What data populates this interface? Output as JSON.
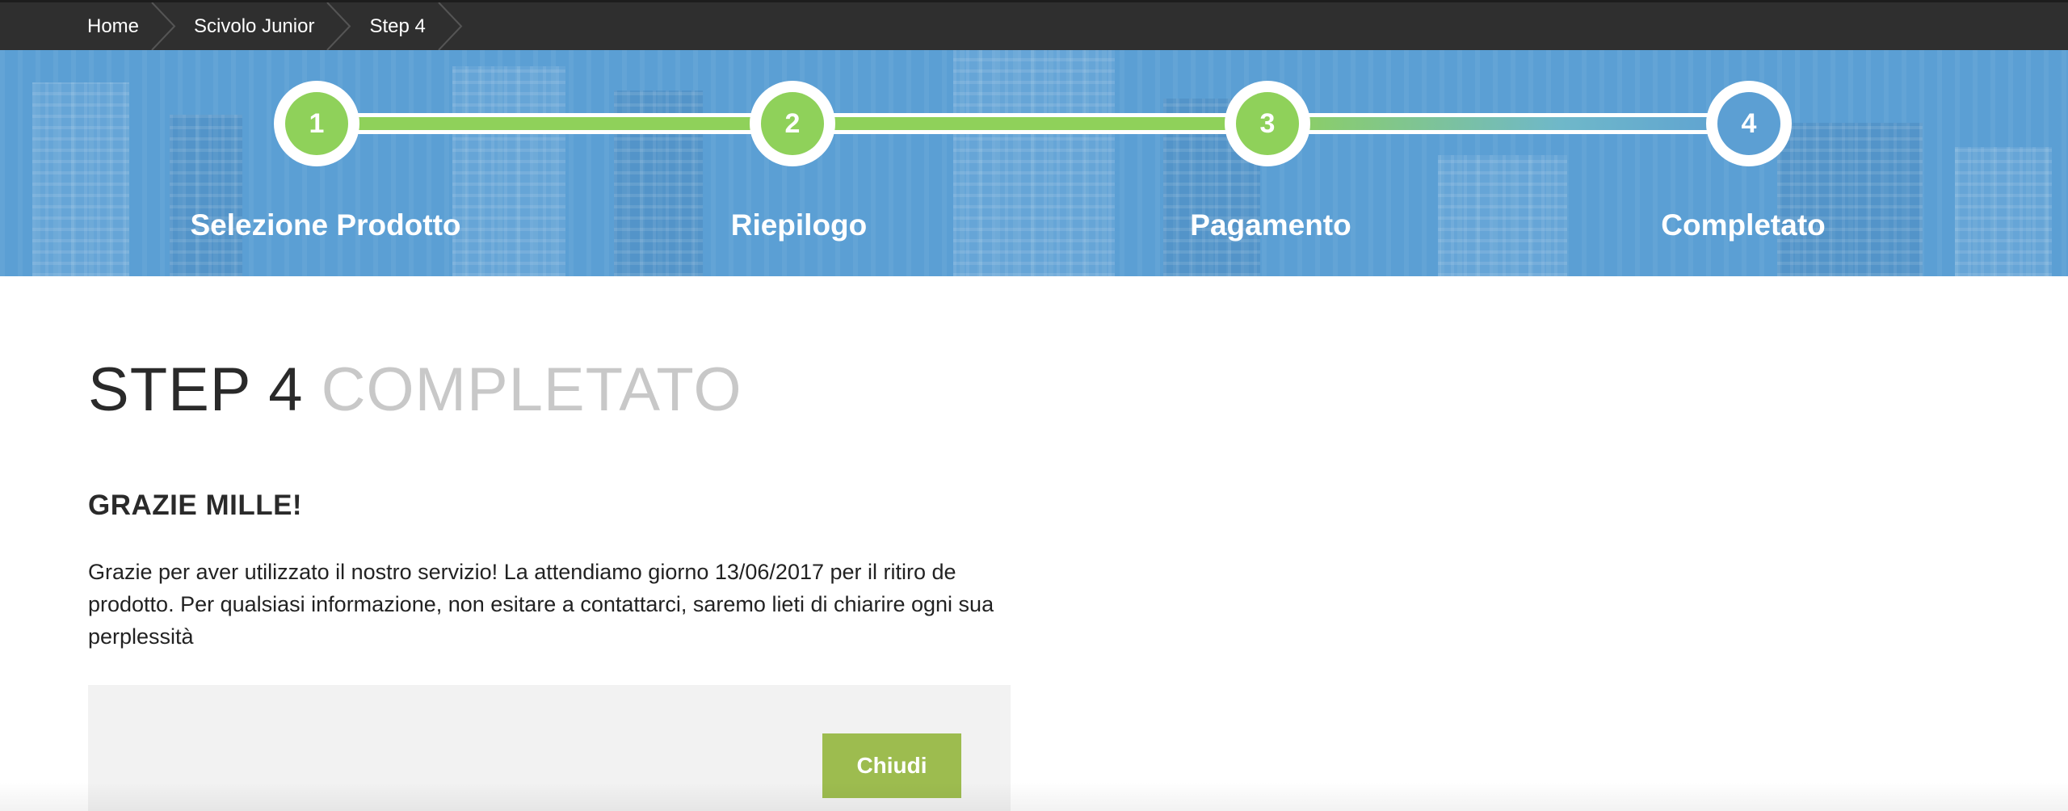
{
  "breadcrumb": {
    "items": [
      {
        "label": "Home"
      },
      {
        "label": "Scivolo Junior"
      },
      {
        "label": "Step 4"
      }
    ]
  },
  "wizard": {
    "steps": [
      {
        "number": "1",
        "label": "Selezione Prodotto",
        "state": "completed"
      },
      {
        "number": "2",
        "label": "Riepilogo",
        "state": "completed"
      },
      {
        "number": "3",
        "label": "Pagamento",
        "state": "completed"
      },
      {
        "number": "4",
        "label": "Completato",
        "state": "current"
      }
    ],
    "colors": {
      "completed": "#8fd15a",
      "current": "#5c9fd3",
      "band": "#5b9fd4"
    }
  },
  "main": {
    "title_prefix": "STEP 4",
    "title_suffix": "COMPLETATO",
    "heading": "GRAZIE MILLE!",
    "message": "Grazie per aver utilizzato il nostro servizio! La attendiamo giorno 13/06/2017 per il ritiro de prodotto. Per qualsiasi informazione, non esitare a contattarci, saremo lieti di chiarire ogni sua perplessità",
    "close_label": "Chiudi",
    "button_color": "#9dbc4f"
  }
}
